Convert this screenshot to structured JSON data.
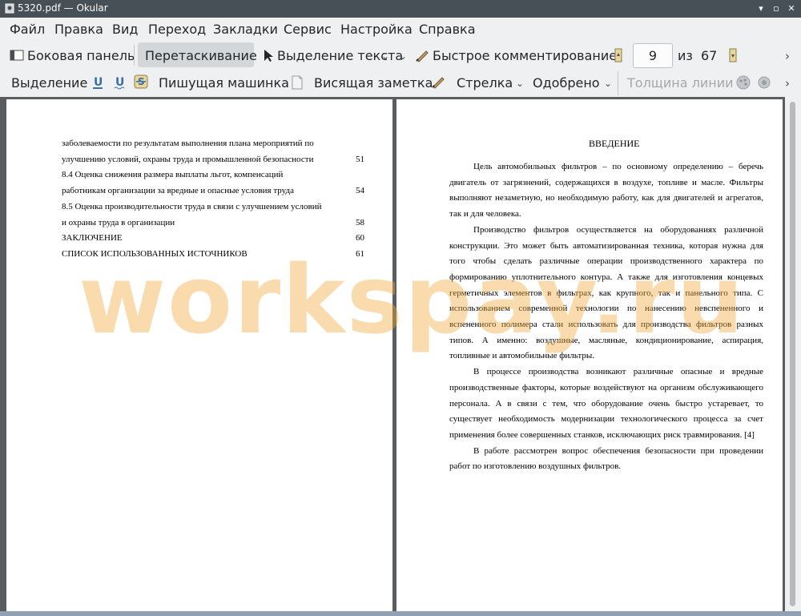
{
  "window": {
    "title": "5320.pdf  — Okular"
  },
  "menu": [
    "Файл",
    "Правка",
    "Вид",
    "Переход",
    "Закладки",
    "Сервис",
    "Настройка",
    "Справка"
  ],
  "toolbar1": {
    "sidebar_label": "Боковая панель",
    "drag_label": "Перетаскивание",
    "text_select_label": "Выделение текста",
    "quick_annot_label": "Быстрое комментирование",
    "page_current": "9",
    "page_of_label": "из",
    "page_total": "67"
  },
  "toolbar2": {
    "highlight_label": "Выделение",
    "typewriter_label": "Пишущая машинка",
    "popup_note_label": "Висящая заметка",
    "arrow_label": "Стрелка",
    "stamp_label": "Одобрено",
    "line_width_label": "Толщина линии"
  },
  "left_page": {
    "toc": [
      {
        "text": "заболеваемости по результатам выполнения плана мероприятий по",
        "num": ""
      },
      {
        "text": "улучшению условий, охраны труда и промышленной безопасности",
        "num": "51"
      },
      {
        "text": "8.4 Оценка снижения размера выплаты льгот, компенсаций",
        "num": ""
      },
      {
        "text": "работникам организации за вредные и опасные условия труда",
        "num": "54"
      },
      {
        "text": "8.5 Оценка производительности труда в связи с улучшением условий",
        "num": ""
      },
      {
        "text": "и охраны труда в организации",
        "num": "58"
      },
      {
        "text": "ЗАКЛЮЧЕНИЕ",
        "num": "60"
      },
      {
        "text": "СПИСОК ИСПОЛЬЗОВАННЫХ ИСТОЧНИКОВ",
        "num": "61"
      }
    ]
  },
  "right_page": {
    "heading": "ВВЕДЕНИЕ",
    "paragraphs": [
      "Цель автомобильных фильтров – по основному определению – беречь двигатель от загрязнений, содержащихся в воздухе, топливе и масле. Фильтры выполняют незаметную, но необходимую работу, как для двигателей и агрегатов, так и для человека.",
      "Производство фильтров осуществляется на оборудованиях различной конструкции. Это может быть автоматизированная техника, которая нужна для того чтобы сделать различные операции производственного характера по формированию уплотнительного контура. А также для изготовления концевых герметичных элементов в фильтрах, как крупного, так и панельного типа. С использованием современной технологии по нанесению невспененного и вспененного полимера стали использовать для производства фильтров разных типов. А именно: воздушные, масляные, кондиционирование, аспирация, топливные и автомобильные фильтры.",
      "В процессе производства возникают различные опасные и вредные производственные факторы, которые воздействуют на организм обслуживающего персонала. А в связи с тем, что оборудование очень быстро устаревает, то существует необходимость модернизации технологического процесса за счет применения более совершенных станков, исключающих риск травмирования. [4]",
      "В работе рассмотрен вопрос обеспечения безопасности при проведении работ по изготовлению воздушных фильтров."
    ]
  },
  "watermark": "workspay.ru",
  "colors": {
    "titlebar": "#475057",
    "accent_watermark": "#f0aa3c",
    "doc_background": "#5a5d60"
  }
}
